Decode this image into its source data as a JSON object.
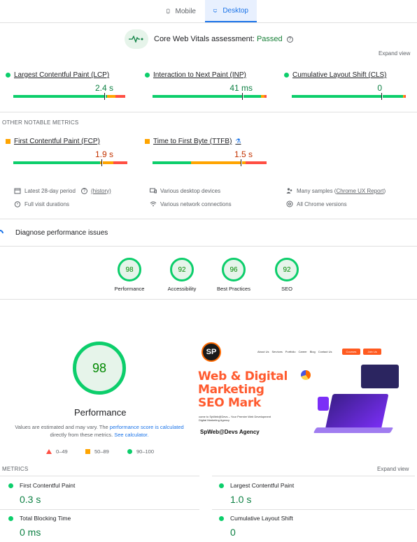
{
  "tabs": [
    {
      "label": "Mobile",
      "icon": "phone-icon"
    },
    {
      "label": "Desktop",
      "icon": "monitor-icon"
    }
  ],
  "cwv": {
    "assessment_label": "Core Web Vitals assessment:",
    "assessment_status": "Passed",
    "expand": "Expand view"
  },
  "core_metrics": [
    {
      "name": "Largest Contentful Paint (LCP)",
      "value": "2.4 s",
      "status": "good"
    },
    {
      "name": "Interaction to Next Paint (INP)",
      "value": "41 ms",
      "status": "good"
    },
    {
      "name": "Cumulative Layout Shift (CLS)",
      "value": "0",
      "status": "good"
    }
  ],
  "other_label": "OTHER NOTABLE METRICS",
  "other_metrics": [
    {
      "name": "First Contentful Paint (FCP)",
      "value": "1.9 s",
      "status": "average"
    },
    {
      "name": "Time to First Byte (TTFB)",
      "value": "1.5 s",
      "status": "average"
    }
  ],
  "info": {
    "period": "Latest 28-day period",
    "history": "(history)",
    "devices": "Various desktop devices",
    "samples_prefix": "Many samples (",
    "samples_link": "Chrome UX Report",
    "samples_suffix": ")",
    "visits": "Full visit durations",
    "network": "Various network connections",
    "chrome": "All Chrome versions"
  },
  "diagnose": "Diagnose performance issues",
  "scores": [
    {
      "label": "Performance",
      "value": "98"
    },
    {
      "label": "Accessibility",
      "value": "92"
    },
    {
      "label": "Best Practices",
      "value": "96"
    },
    {
      "label": "SEO",
      "value": "92"
    }
  ],
  "performance": {
    "score": "98",
    "title": "Performance",
    "note_a": "Values are estimated and may vary. The ",
    "note_link1": "performance score is calculated",
    "note_b": "directly from these metrics. ",
    "note_link2": "See calculator."
  },
  "legend": [
    {
      "range": "0–49",
      "color": "#ff4e42"
    },
    {
      "range": "50–89",
      "color": "#ffa400"
    },
    {
      "range": "90–100",
      "color": "#0cce6b"
    }
  ],
  "lab": {
    "label": "METRICS",
    "expand": "Expand view",
    "items": [
      {
        "name": "First Contentful Paint",
        "value": "0.3 s"
      },
      {
        "name": "Largest Contentful Paint",
        "value": "1.0 s"
      },
      {
        "name": "Total Blocking Time",
        "value": "0 ms"
      },
      {
        "name": "Cumulative Layout Shift",
        "value": "0"
      }
    ]
  },
  "screenshot": {
    "nav": [
      "About Us",
      "Services",
      "Portfolio",
      "Career",
      "Blog",
      "Contact Us"
    ],
    "btn1": "Courses",
    "btn2": "Join Us",
    "logo": "SP",
    "title_lines": [
      "Web & Digital",
      "Marketing",
      "SEO Mark"
    ],
    "sub1": "come to SpWeb@Devs – Your Premier Web Development",
    "sub2": "Digital Marketing Agency",
    "agency": "SpWeb@Devs Agency"
  }
}
